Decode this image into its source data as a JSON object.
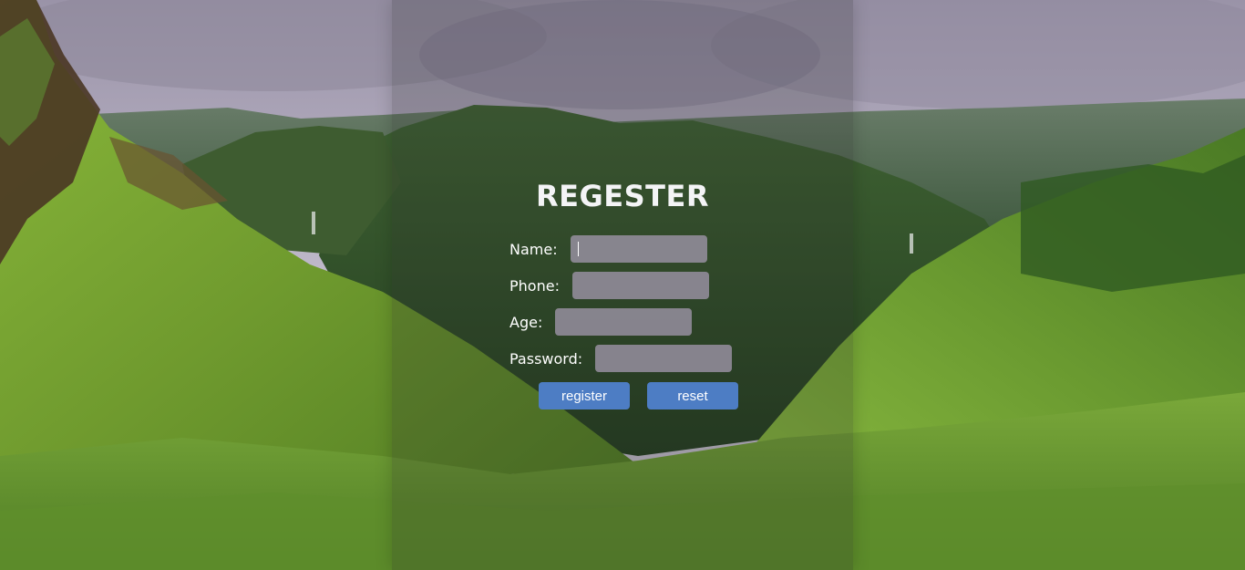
{
  "form": {
    "title": "REGESTER",
    "fields": {
      "name": {
        "label": "Name:",
        "value": ""
      },
      "phone": {
        "label": "Phone:",
        "value": ""
      },
      "age": {
        "label": "Age:",
        "value": ""
      },
      "password": {
        "label": "Password:",
        "value": ""
      }
    },
    "buttons": {
      "register": "register",
      "reset": "reset"
    }
  },
  "colors": {
    "button": "#4d7dc4",
    "input_bg": "#a096aa",
    "text": "#ffffff"
  }
}
